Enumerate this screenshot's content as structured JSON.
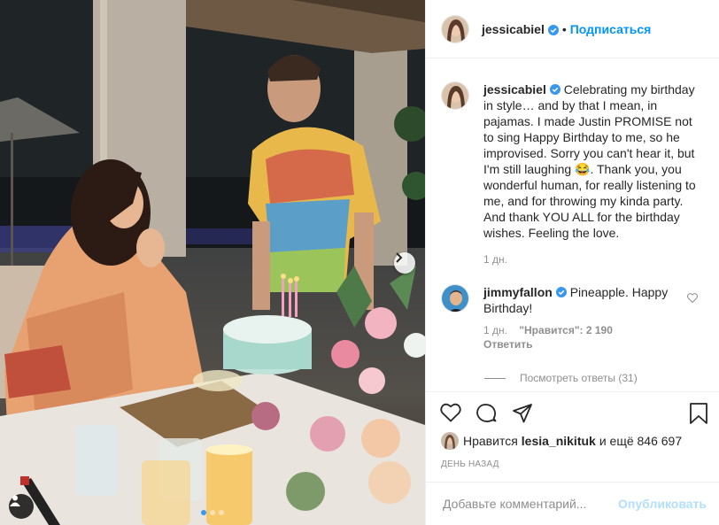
{
  "post": {
    "author": "jessicabiel",
    "follow_label": "Подписаться",
    "separator": "•",
    "caption": "Celebrating my birthday in style… and by that I mean, in pajamas. I made Justin PROMISE not to sing Happy Birthday to me, so he improvised. Sorry you can't hear it, but I'm still laughing 😂. Thank you, you wonderful human, for really listening to me, and for throwing my kinda party. And thank YOU ALL for the birthday wishes. Feeling the love.",
    "caption_age": "1 дн.",
    "carousel": {
      "slide_count": 3,
      "current_slide": 1
    }
  },
  "comments": [
    {
      "author": "jimmyfallon",
      "text": "Pineapple. Happy Birthday!",
      "age": "1 дн.",
      "likes_label": "\"Нравится\": 2 190",
      "reply_label": "Ответить",
      "view_replies_label": "Посмотреть ответы (31)"
    }
  ],
  "likes": {
    "prefix": "Нравится",
    "user": "lesia_nikituk",
    "suffix": "и ещё 846 697"
  },
  "timestamp": "ДЕНЬ НАЗАД",
  "add_comment": {
    "placeholder": "Добавьте комментарий...",
    "publish_label": "Опубликовать"
  },
  "colors": {
    "accent": "#0095f6",
    "verified": "#3897f0",
    "publish_disabled": "#b2dffc",
    "muted": "#8e8e8e"
  },
  "icons": [
    "verified-badge-icon",
    "chevron-right-icon",
    "user-tag-icon",
    "heart-icon",
    "comment-icon",
    "share-icon",
    "bookmark-icon",
    "small-heart-icon"
  ]
}
